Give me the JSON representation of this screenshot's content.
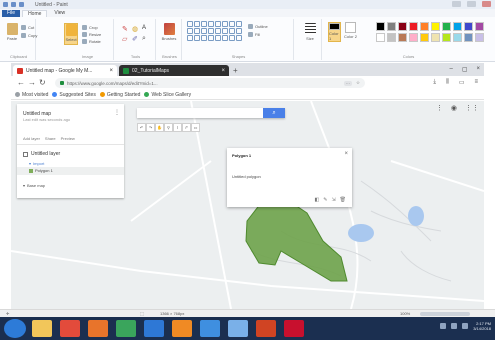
{
  "paint": {
    "title": "Untitled - Paint",
    "tabs": [
      "File",
      "Home",
      "View"
    ],
    "groups": [
      "Clipboard",
      "Image",
      "Tools",
      "Brushes",
      "Shapes",
      "Size",
      "Colors"
    ],
    "buttons": {
      "paste": "Paste",
      "cut": "Cut",
      "copy": "Copy",
      "select": "Select",
      "crop": "Crop",
      "resize": "Resize",
      "rotate": "Rotate",
      "brushes": "Brushes",
      "outline": "Outline",
      "fill": "Fill",
      "size": "Size",
      "color1": "Color 1",
      "color2": "Color 2",
      "edit_colors": "Edit colors"
    },
    "palette": [
      "#000000",
      "#7f7f7f",
      "#880015",
      "#ed1c24",
      "#ff7f27",
      "#fff200",
      "#22b14c",
      "#00a2e8",
      "#3f48cc",
      "#a349a4",
      "#ffffff",
      "#c3c3c3",
      "#b97a57",
      "#ffaec9",
      "#ffc90e",
      "#efe4b0",
      "#b5e61d",
      "#99d9ea",
      "#7092be",
      "#c8bfe7"
    ],
    "status": {
      "dimensions": "1366 × 768px",
      "zoom": "100%"
    }
  },
  "browser": {
    "tabs": [
      {
        "label": "Untitled map - Google My M...",
        "fav_color": "#d93025",
        "active": true
      },
      {
        "label": "02_TutorialMaps",
        "fav_color": "#1e8e3e",
        "active": false
      }
    ],
    "url": "https://www.google.com/maps/d/edit?mid=1...",
    "bookmarks": [
      {
        "label": "Most visited",
        "color": "#9aa0a6"
      },
      {
        "label": "Suggested Sites",
        "color": "#4285f4"
      },
      {
        "label": "Getting Started",
        "color": "#f29900"
      },
      {
        "label": "Web Slice Gallery",
        "color": "#34a853"
      }
    ]
  },
  "map_panel": {
    "title": "Untitled map",
    "subtitle": "Last edit was seconds ago",
    "actions": [
      "Add layer",
      "Share",
      "Preview"
    ],
    "layer_name": "Untitled layer",
    "import_link": "Import",
    "feature": "Polygon 1",
    "base_map": "Base map"
  },
  "search": {
    "placeholder": ""
  },
  "popup": {
    "title": "Polygon 1",
    "body": "Untitled polygon"
  },
  "taskbar": {
    "time": "2:17 PM",
    "date": "3/14/2018",
    "apps": [
      {
        "name": "explorer-icon",
        "color": "#f2c65a"
      },
      {
        "name": "chrome-icon",
        "color": "#e34b3b"
      },
      {
        "name": "firefox-icon",
        "color": "#e8742b"
      },
      {
        "name": "app-icon-green",
        "color": "#3aa55c"
      },
      {
        "name": "media-icon",
        "color": "#2e78d6"
      },
      {
        "name": "vlc-icon",
        "color": "#f08a24"
      },
      {
        "name": "app-icon-blue",
        "color": "#3f8fe0"
      },
      {
        "name": "paint-icon",
        "color": "#7ab0e8"
      },
      {
        "name": "ppt-icon",
        "color": "#d04423"
      },
      {
        "name": "pdf-icon",
        "color": "#c8102e"
      }
    ]
  }
}
